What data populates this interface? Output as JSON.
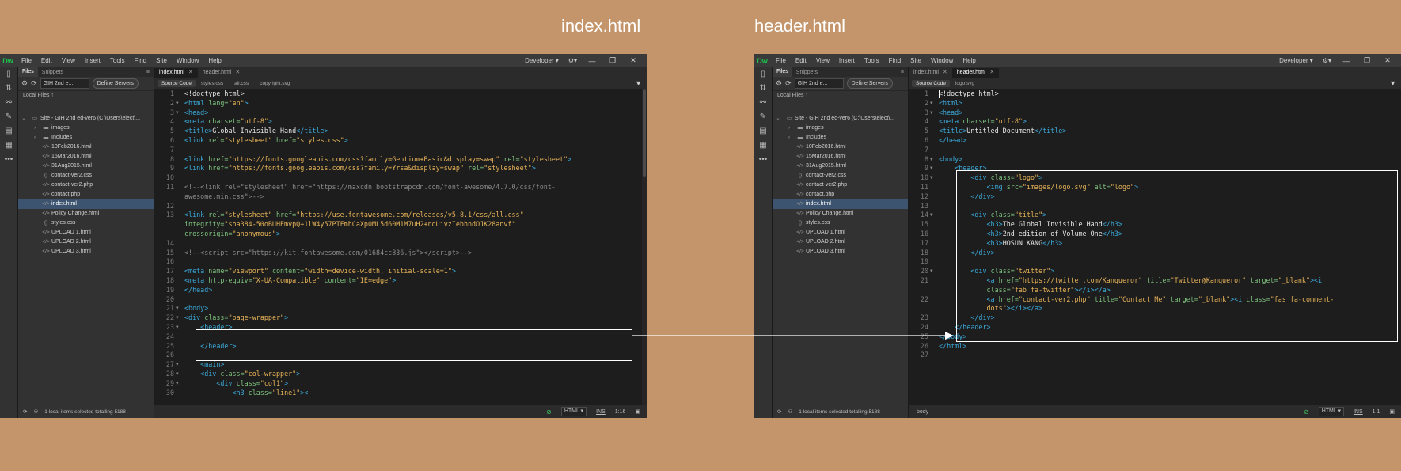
{
  "captions": {
    "left": "index.html",
    "right": "header.html"
  },
  "menubar": {
    "logo": "Dw",
    "items": [
      "File",
      "Edit",
      "View",
      "Insert",
      "Tools",
      "Find",
      "Site",
      "Window",
      "Help"
    ],
    "workspace": "Developer"
  },
  "files_panel": {
    "tabs": [
      "Files",
      "Snippets"
    ],
    "site_select": "GIH 2nd e...",
    "define_servers": "Define Servers",
    "local_files": "Local Files",
    "site_root": "Site - GIH 2nd ed-ver6 (C:\\Users\\elect\\...",
    "items": [
      {
        "name": "images",
        "type": "folder"
      },
      {
        "name": "Includes",
        "type": "folder"
      },
      {
        "name": "10Feb2016.html",
        "type": "html"
      },
      {
        "name": "15Mar2016.html",
        "type": "html"
      },
      {
        "name": "31Aug2015.html",
        "type": "html"
      },
      {
        "name": "contact-ver2.css",
        "type": "css"
      },
      {
        "name": "contact-ver2.php",
        "type": "html"
      },
      {
        "name": "contact.php",
        "type": "html"
      },
      {
        "name": "index.html",
        "type": "html"
      },
      {
        "name": "Policy Change.html",
        "type": "html"
      },
      {
        "name": "styles.css",
        "type": "css"
      },
      {
        "name": "UPLOAD 1.html",
        "type": "html"
      },
      {
        "name": "UPLOAD 2.html",
        "type": "html"
      },
      {
        "name": "UPLOAD 3.html",
        "type": "html"
      }
    ],
    "status": "1 local items selected totalling 5188"
  },
  "left_editor": {
    "tabs": [
      "index.html",
      "header.html"
    ],
    "related": [
      "Source Code",
      "styles.css",
      "all.css",
      "copyright.svg"
    ],
    "status": {
      "lang": "HTML",
      "mode": "INS",
      "pos": "1:16",
      "tag": ""
    },
    "lines": [
      {
        "n": "1",
        "f": "",
        "h": "<span class='txt'>&lt;!doctype html&gt;</span>"
      },
      {
        "n": "2",
        "f": "▼",
        "h": "<span class='tag'>&lt;html</span> <span class='attr'>lang=</span><span class='str'>\"en\"</span><span class='tag'>&gt;</span>"
      },
      {
        "n": "3",
        "f": "▼",
        "h": "<span class='tag'>&lt;head&gt;</span>"
      },
      {
        "n": "4",
        "f": "",
        "h": "<span class='tag'>&lt;meta</span> <span class='attr'>charset=</span><span class='str'>\"utf-8\"</span><span class='tag'>&gt;</span>"
      },
      {
        "n": "5",
        "f": "",
        "h": "<span class='tag'>&lt;title&gt;</span><span class='txt'>Global Invisible Hand</span><span class='tag'>&lt;/title&gt;</span>"
      },
      {
        "n": "6",
        "f": "",
        "h": "<span class='tag'>&lt;link</span> <span class='attr'>rel=</span><span class='str'>\"stylesheet\"</span> <span class='attr'>href=</span><span class='str'>\"styles.css\"</span><span class='tag'>&gt;</span>"
      },
      {
        "n": "7",
        "f": "",
        "h": ""
      },
      {
        "n": "8",
        "f": "",
        "h": "<span class='tag'>&lt;link</span> <span class='attr'>href=</span><span class='str'>\"https://fonts.googleapis.com/css?family=Gentium+Basic&amp;display=swap\"</span> <span class='attr'>rel=</span><span class='str'>\"stylesheet\"</span><span class='tag'>&gt;</span>"
      },
      {
        "n": "9",
        "f": "",
        "h": "<span class='tag'>&lt;link</span> <span class='attr'>href=</span><span class='str'>\"https://fonts.googleapis.com/css?family=Yrsa&amp;display=swap\"</span> <span class='attr'>rel=</span><span class='str'>\"stylesheet\"</span><span class='tag'>&gt;</span>"
      },
      {
        "n": "10",
        "f": "",
        "h": ""
      },
      {
        "n": "11",
        "f": "",
        "h": "<span class='cmt'>&lt;!--&lt;link rel=\"stylesheet\" href=\"https://maxcdn.bootstrapcdn.com/font-awesome/4.7.0/css/font-</span>"
      },
      {
        "n": "",
        "f": "",
        "h": "<span class='cmt'>awesome.min.css\"&gt;--&gt;</span>"
      },
      {
        "n": "12",
        "f": "",
        "h": ""
      },
      {
        "n": "13",
        "f": "",
        "h": "<span class='tag'>&lt;link</span> <span class='attr'>rel=</span><span class='str'>\"stylesheet\"</span> <span class='attr'>href=</span><span class='str'>\"https://use.fontawesome.com/releases/v5.8.1/css/all.css\"</span>"
      },
      {
        "n": "",
        "f": "",
        "h": "<span class='attr'>integrity=</span><span class='str'>\"sha384-50oBUHEmvpQ+1lW4y57PTFmhCaXp0ML5d60M1M7uH2+nqUivzIebhndOJK28anvf\"</span>"
      },
      {
        "n": "",
        "f": "",
        "h": "<span class='attr'>crossorigin=</span><span class='str'>\"anonymous\"</span><span class='tag'>&gt;</span>"
      },
      {
        "n": "14",
        "f": "",
        "h": ""
      },
      {
        "n": "15",
        "f": "",
        "h": "<span class='cmt'>&lt;!--&lt;script src=\"https://kit.fontawesome.com/01684cc836.js\"&gt;&lt;/script&gt;--&gt;</span>"
      },
      {
        "n": "16",
        "f": "",
        "h": ""
      },
      {
        "n": "17",
        "f": "",
        "h": "<span class='tag'>&lt;meta</span> <span class='attr'>name=</span><span class='str'>\"viewport\"</span> <span class='attr'>content=</span><span class='str'>\"width=device-width, initial-scale=1\"</span><span class='tag'>&gt;</span>"
      },
      {
        "n": "18",
        "f": "",
        "h": "<span class='tag'>&lt;meta</span> <span class='attr'>http-equiv=</span><span class='str'>\"X-UA-Compatible\"</span> <span class='attr'>content=</span><span class='str'>\"IE=edge\"</span><span class='tag'>&gt;</span>"
      },
      {
        "n": "19",
        "f": "",
        "h": "<span class='tag'>&lt;/head&gt;</span>"
      },
      {
        "n": "20",
        "f": "",
        "h": ""
      },
      {
        "n": "21",
        "f": "▼",
        "h": "<span class='tag'>&lt;body&gt;</span>"
      },
      {
        "n": "22",
        "f": "▼",
        "h": "<span class='tag'>&lt;div</span> <span class='attr'>class=</span><span class='str'>\"page-wrapper\"</span><span class='tag'>&gt;</span>"
      },
      {
        "n": "23",
        "f": "▼",
        "h": "    <span class='tag'>&lt;header&gt;</span>"
      },
      {
        "n": "24",
        "f": "",
        "h": ""
      },
      {
        "n": "25",
        "f": "",
        "h": "    <span class='tag'>&lt;/header&gt;</span>"
      },
      {
        "n": "26",
        "f": "",
        "h": ""
      },
      {
        "n": "27",
        "f": "▼",
        "h": "    <span class='tag'>&lt;main&gt;</span>"
      },
      {
        "n": "28",
        "f": "▼",
        "h": "    <span class='tag'>&lt;div</span> <span class='attr'>class=</span><span class='str'>\"col-wrapper\"</span><span class='tag'>&gt;</span>"
      },
      {
        "n": "29",
        "f": "▼",
        "h": "        <span class='tag'>&lt;div</span> <span class='attr'>class=</span><span class='str'>\"col1\"</span><span class='tag'>&gt;</span>"
      },
      {
        "n": "30",
        "f": "",
        "h": "            <span class='tag'>&lt;h3</span> <span class='attr'>class=</span><span class='str'>\"line1\"</span><span class='tag'>&gt;&lt;</span>"
      }
    ]
  },
  "right_editor": {
    "tabs": [
      "index.html",
      "header.html"
    ],
    "related": [
      "Source Code",
      "logo.svg"
    ],
    "status": {
      "lang": "HTML",
      "mode": "INS",
      "pos": "1:1",
      "tag": "body"
    },
    "lines": [
      {
        "n": "1",
        "f": "",
        "h": "<span class='cursor'></span><span class='txt'>&lt;!doctype html&gt;</span>"
      },
      {
        "n": "2",
        "f": "▼",
        "h": "<span class='tag'>&lt;html&gt;</span>"
      },
      {
        "n": "3",
        "f": "▼",
        "h": "<span class='tag'>&lt;head&gt;</span>"
      },
      {
        "n": "4",
        "f": "",
        "h": "<span class='tag'>&lt;meta</span> <span class='attr'>charset=</span><span class='str'>\"utf-8\"</span><span class='tag'>&gt;</span>"
      },
      {
        "n": "5",
        "f": "",
        "h": "<span class='tag'>&lt;title&gt;</span><span class='txt'>Untitled Document</span><span class='tag'>&lt;/title&gt;</span>"
      },
      {
        "n": "6",
        "f": "",
        "h": "<span class='tag'>&lt;/head&gt;</span>"
      },
      {
        "n": "7",
        "f": "",
        "h": ""
      },
      {
        "n": "8",
        "f": "▼",
        "h": "<span class='tag'>&lt;body&gt;</span>"
      },
      {
        "n": "9",
        "f": "▼",
        "h": "    <span class='tag'>&lt;header&gt;</span>"
      },
      {
        "n": "10",
        "f": "▼",
        "h": "        <span class='tag'>&lt;div</span> <span class='attr'>class=</span><span class='str'>\"logo\"</span><span class='tag'>&gt;</span>"
      },
      {
        "n": "11",
        "f": "",
        "h": "            <span class='tag'>&lt;img</span> <span class='attr'>src=</span><span class='str'>\"images/logo.svg\"</span> <span class='attr'>alt=</span><span class='str'>\"logo\"</span><span class='tag'>&gt;</span>"
      },
      {
        "n": "12",
        "f": "",
        "h": "        <span class='tag'>&lt;/div&gt;</span>"
      },
      {
        "n": "13",
        "f": "",
        "h": ""
      },
      {
        "n": "14",
        "f": "▼",
        "h": "        <span class='tag'>&lt;div</span> <span class='attr'>class=</span><span class='str'>\"title\"</span><span class='tag'>&gt;</span>"
      },
      {
        "n": "15",
        "f": "",
        "h": "            <span class='tag'>&lt;h3&gt;</span><span class='txt'>The Global Invisible Hand</span><span class='tag'>&lt;/h3&gt;</span>"
      },
      {
        "n": "16",
        "f": "",
        "h": "            <span class='tag'>&lt;h3&gt;</span><span class='txt'>2nd edition of Volume One</span><span class='tag'>&lt;/h3&gt;</span>"
      },
      {
        "n": "17",
        "f": "",
        "h": "            <span class='tag'>&lt;h3&gt;</span><span class='txt'>HOSUN KANG</span><span class='tag'>&lt;/h3&gt;</span>"
      },
      {
        "n": "18",
        "f": "",
        "h": "        <span class='tag'>&lt;/div&gt;</span>"
      },
      {
        "n": "19",
        "f": "",
        "h": ""
      },
      {
        "n": "20",
        "f": "▼",
        "h": "        <span class='tag'>&lt;div</span> <span class='attr'>class=</span><span class='str'>\"twitter\"</span><span class='tag'>&gt;</span>"
      },
      {
        "n": "21",
        "f": "",
        "h": "            <span class='tag'>&lt;a</span> <span class='attr'>href=</span><span class='str'>\"https://twitter.com/Kanqueror\"</span> <span class='attr'>title=</span><span class='str'>\"Twitter@Kanqueror\"</span> <span class='attr'>target=</span><span class='str'>\"_blank\"</span><span class='tag'>&gt;&lt;i</span>"
      },
      {
        "n": "",
        "f": "",
        "h": "            <span class='attr'>class=</span><span class='str'>\"fab fa-twitter\"</span><span class='tag'>&gt;&lt;/i&gt;&lt;/a&gt;</span>"
      },
      {
        "n": "22",
        "f": "",
        "h": "            <span class='tag'>&lt;a</span> <span class='attr'>href=</span><span class='str'>\"contact-ver2.php\"</span> <span class='attr'>title=</span><span class='str'>\"Contact Me\"</span> <span class='attr'>target=</span><span class='str'>\"_blank\"</span><span class='tag'>&gt;&lt;i</span> <span class='attr'>class=</span><span class='str'>\"fas fa-comment-</span>"
      },
      {
        "n": "",
        "f": "",
        "h": "            <span class='str'>dots\"</span><span class='tag'>&gt;&lt;/i&gt;&lt;/a&gt;</span>"
      },
      {
        "n": "23",
        "f": "",
        "h": "        <span class='tag'>&lt;/div&gt;</span>"
      },
      {
        "n": "24",
        "f": "",
        "h": "    <span class='tag'>&lt;/header&gt;</span>"
      },
      {
        "n": "25",
        "f": "",
        "h": "<span class='tag'>&lt;/body&gt;</span>"
      },
      {
        "n": "26",
        "f": "",
        "h": "<span class='tag'>&lt;/html&gt;</span>"
      },
      {
        "n": "27",
        "f": "",
        "h": ""
      }
    ]
  }
}
